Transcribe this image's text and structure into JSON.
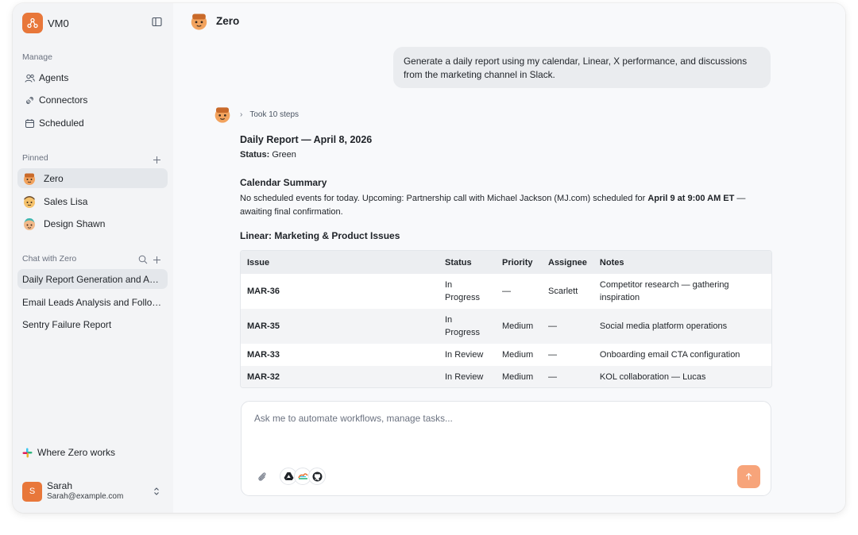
{
  "colors": {
    "accent": "#e8773a",
    "send_button": "#f7a47a",
    "sidebar_bg": "#f3f4f6",
    "active_item": "#e4e7eb"
  },
  "workspace": {
    "name": "VM0",
    "logo_icon": "workspace-logo-icon"
  },
  "sidebar": {
    "manage_title": "Manage",
    "manage_items": [
      {
        "label": "Agents",
        "icon": "agents-icon"
      },
      {
        "label": "Connectors",
        "icon": "connectors-icon"
      },
      {
        "label": "Scheduled",
        "icon": "calendar-icon"
      }
    ],
    "pinned_title": "Pinned",
    "pinned_items": [
      {
        "label": "Zero"
      },
      {
        "label": "Sales Lisa"
      },
      {
        "label": "Design Shawn"
      }
    ],
    "chat_title": "Chat with Zero",
    "chats": [
      {
        "label": "Daily Report Generation and Analysis"
      },
      {
        "label": "Email Leads Analysis and Follow-up"
      },
      {
        "label": "Sentry Failure Report"
      }
    ],
    "where_works": "Where Zero works",
    "user": {
      "initial": "S",
      "name": "Sarah",
      "email": "Sarah@example.com"
    }
  },
  "main": {
    "agent_name": "Zero",
    "user_message": "Generate a daily report using my calendar, Linear, X performance, and discussions from the marketing channel in Slack.",
    "steps_label": "Took 10 steps",
    "report": {
      "title": "Daily Report — April 8, 2026",
      "status_label": "Status:",
      "status_value": " Green",
      "calendar_heading": "Calendar Summary",
      "calendar_text_1": "No scheduled events for today. Upcoming: Partnership call with Michael Jackson (MJ.com) scheduled for ",
      "calendar_text_bold": "April 9 at 9:00 AM ET",
      "calendar_text_2": " —",
      "calendar_text_3": "awaiting final confirmation.",
      "linear_heading": "Linear: Marketing & Product Issues"
    },
    "table": {
      "headers": [
        "Issue",
        "Status",
        "Priority",
        "Assignee",
        "Notes"
      ],
      "rows": [
        {
          "issue": "MAR-36",
          "status": "In Progress",
          "priority": "—",
          "assignee": "Scarlett",
          "notes": "Competitor research — gathering inspiration"
        },
        {
          "issue": "MAR-35",
          "status": "In Progress",
          "priority": "Medium",
          "assignee": "—",
          "notes": "Social media platform operations"
        },
        {
          "issue": "MAR-33",
          "status": "In Review",
          "priority": "Medium",
          "assignee": "—",
          "notes": "Onboarding email CTA configuration"
        },
        {
          "issue": "MAR-32",
          "status": "In Review",
          "priority": "Medium",
          "assignee": "—",
          "notes": "KOL collaboration — Lucas"
        }
      ]
    },
    "composer": {
      "placeholder": "Ask me to automate workflows, manage tasks...",
      "integrations": [
        "google-drive-icon",
        "cloud-app-icon",
        "github-icon"
      ]
    }
  }
}
